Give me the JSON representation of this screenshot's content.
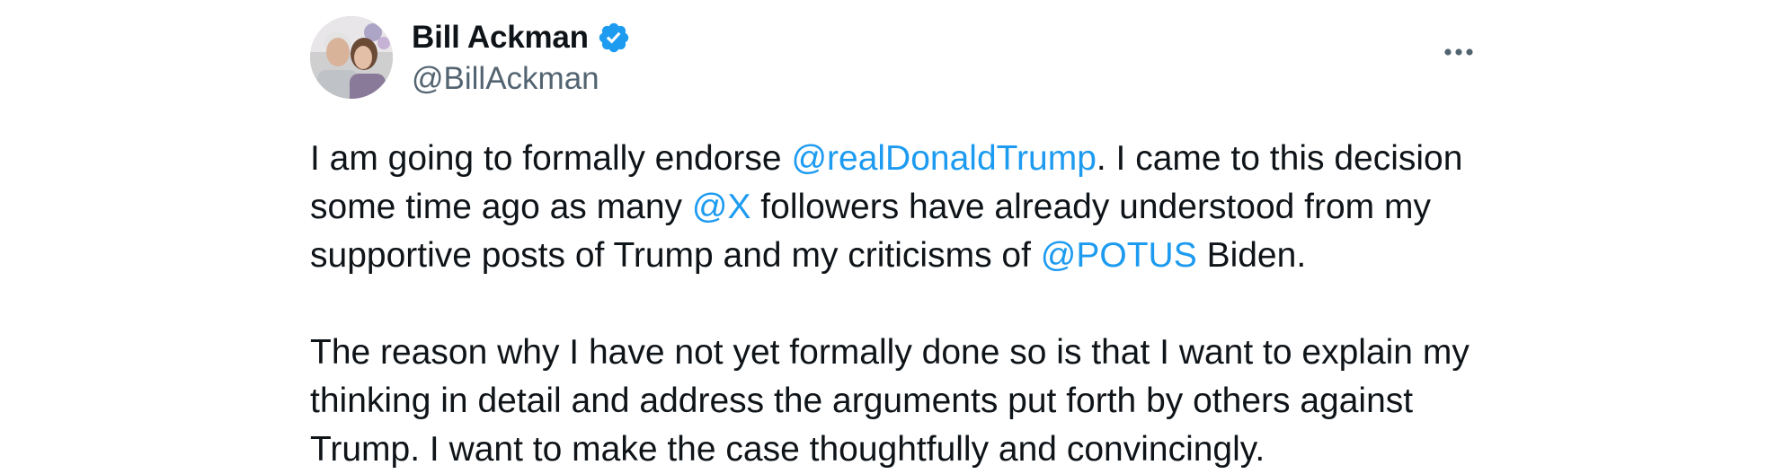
{
  "author": {
    "display_name": "Bill Ackman",
    "handle": "@BillAckman",
    "verified": true,
    "avatar": "profile-photo"
  },
  "menu": {
    "icon": "more-horizontal-icon"
  },
  "tweet": {
    "paragraphs": [
      {
        "segments": [
          {
            "type": "text",
            "text": "I am going to formally endorse "
          },
          {
            "type": "mention",
            "text": "@realDonaldTrump"
          },
          {
            "type": "text",
            "text": ". I came to this decision some time ago as many "
          },
          {
            "type": "mention",
            "text": "@X"
          },
          {
            "type": "text",
            "text": " followers have already understood from my supportive posts of Trump and my criticisms of "
          },
          {
            "type": "mention",
            "text": "@POTUS"
          },
          {
            "type": "text",
            "text": " Biden."
          }
        ]
      },
      {
        "segments": [
          {
            "type": "text",
            "text": "The reason why I have not yet formally done so is that I want to explain my thinking in detail and address the arguments put forth by others against Trump. I want to make the case thoughtfully and convincingly."
          }
        ]
      }
    ]
  },
  "colors": {
    "text": "#0f1419",
    "secondary": "#536471",
    "link": "#1d9bf0",
    "verified": "#1d9bf0"
  }
}
